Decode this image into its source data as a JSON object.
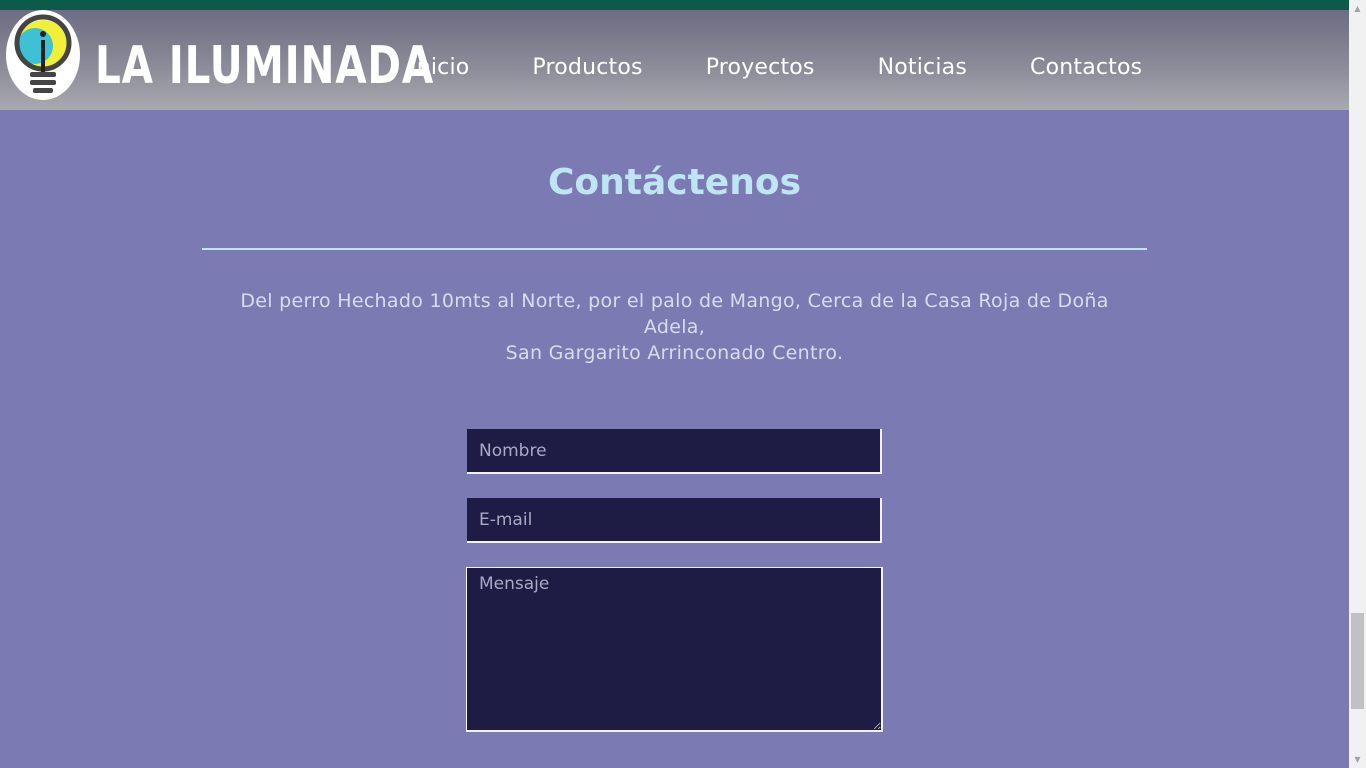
{
  "header": {
    "brand": "LA ILUMINADA",
    "logo_icon": "lightbulb-icon",
    "nav": [
      {
        "label": "Inicio"
      },
      {
        "label": "Productos"
      },
      {
        "label": "Proyectos"
      },
      {
        "label": "Noticias"
      },
      {
        "label": "Contactos"
      }
    ]
  },
  "contact": {
    "title": "Contáctenos",
    "address_line1": "Del perro Hechado 10mts al Norte, por el palo de Mango, Cerca de la Casa Roja de Doña Adela,",
    "address_line2": "San Gargarito Arrinconado Centro."
  },
  "form": {
    "name_placeholder": "Nombre",
    "email_placeholder": "E-mail",
    "message_placeholder": "Mensaje"
  },
  "colors": {
    "background": "#7c7ab2",
    "top_strip": "#0c5a4a",
    "title": "#bfe4f4",
    "field_bg": "#1e1c44"
  }
}
